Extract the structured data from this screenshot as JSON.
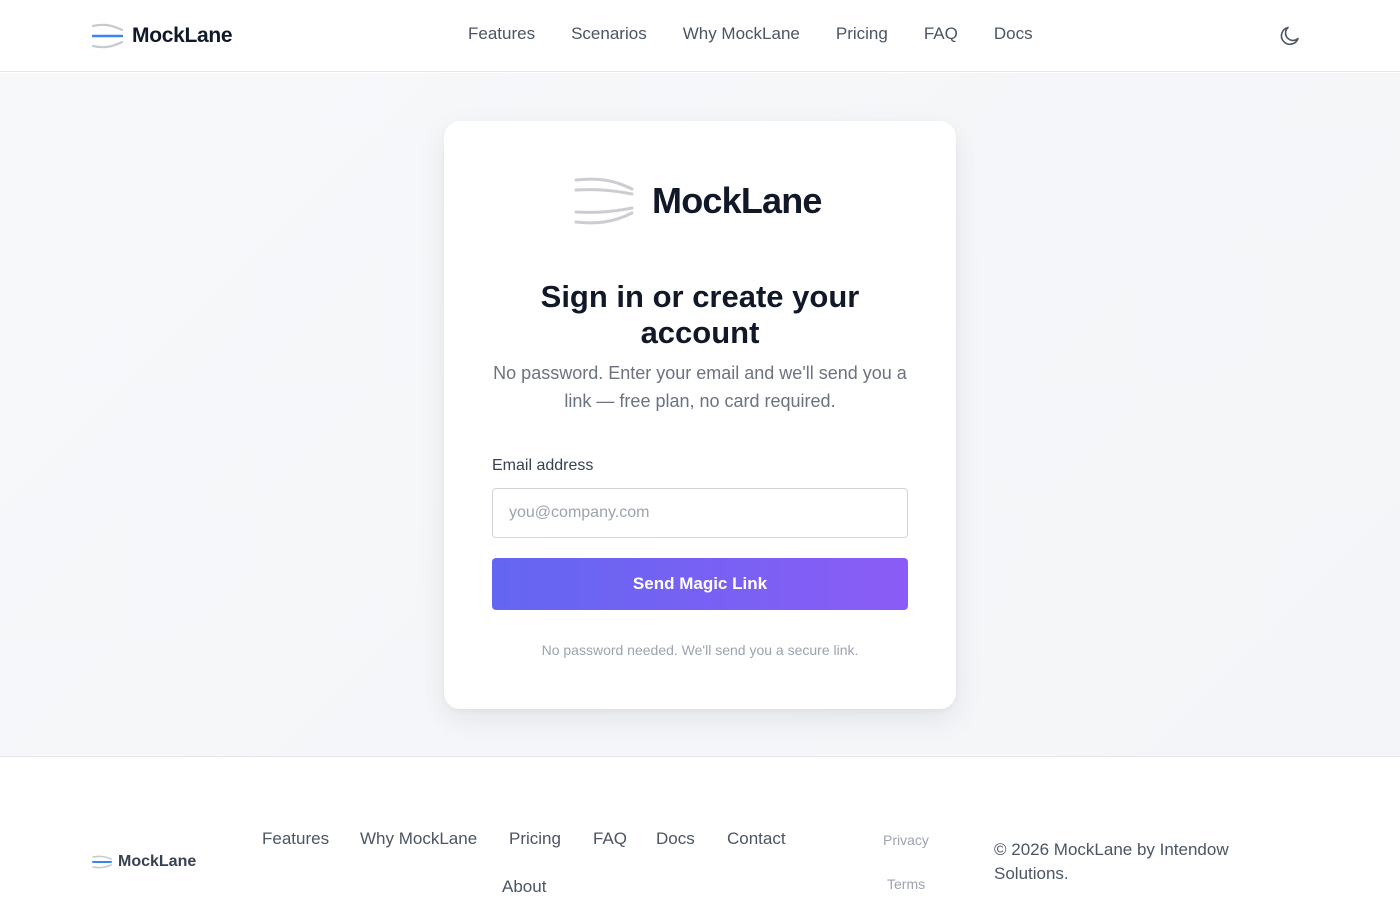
{
  "header": {
    "brand": "MockLane",
    "nav": [
      "Features",
      "Scenarios",
      "Why MockLane",
      "Pricing",
      "FAQ",
      "Docs"
    ],
    "theme_toggle_icon": "moon-icon"
  },
  "card": {
    "brand": "MockLane",
    "title": "Sign in or create your account",
    "subtitle": "No password. Enter your email and we'll send you a link — free plan, no card required.",
    "email_label": "Email address",
    "email_value": "",
    "email_placeholder": "you@company.com",
    "submit_label": "Send Magic Link",
    "note": "No password needed. We'll send you a secure link."
  },
  "footer": {
    "brand": "MockLane",
    "links": [
      "Features",
      "Why MockLane",
      "Pricing",
      "FAQ",
      "Docs",
      "Contact",
      "About"
    ],
    "legal": [
      "Privacy",
      "Terms"
    ],
    "copyright": "© 2026 MockLane by Intendow Solutions."
  },
  "colors": {
    "accent_start": "#6366f1",
    "accent_end": "#8b5cf6",
    "logo_line": "#3b82f6"
  }
}
